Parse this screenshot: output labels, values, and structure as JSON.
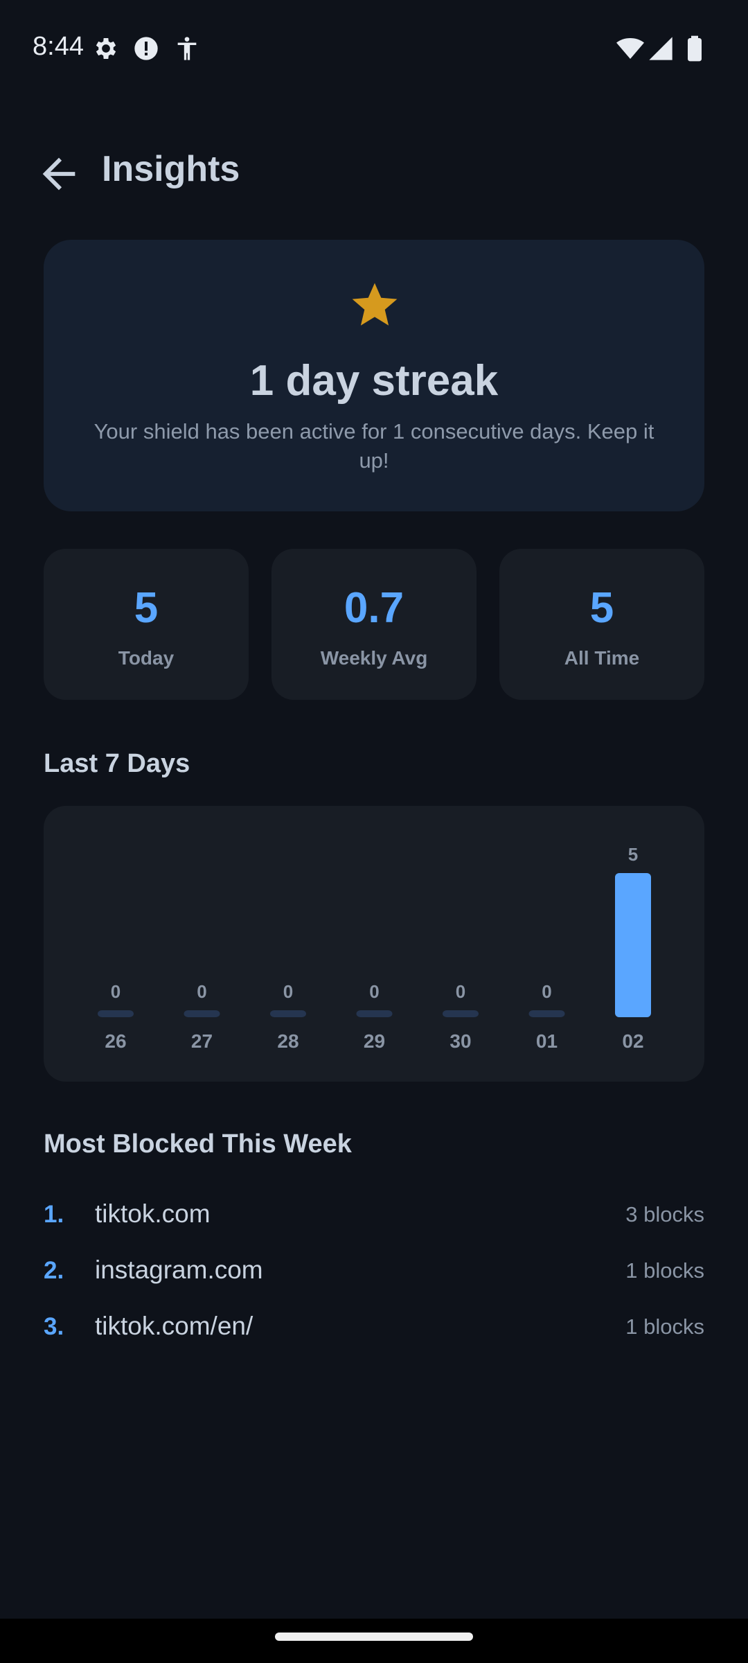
{
  "status_bar": {
    "time": "8:44",
    "left_icons": [
      "gear-icon",
      "alert-circle-icon",
      "accessibility-icon"
    ],
    "right_icons": [
      "wifi-icon",
      "cellular-signal-icon",
      "battery-icon"
    ]
  },
  "app_bar": {
    "back_icon": "arrow-left-icon",
    "title": "Insights"
  },
  "streak": {
    "icon": "star-icon",
    "star_color": "#d69a1e",
    "title": "1 day streak",
    "subtitle": "Your shield has been active for 1 consecutive days. Keep it up!"
  },
  "stats": [
    {
      "value": "5",
      "label": "Today"
    },
    {
      "value": "0.7",
      "label": "Weekly Avg"
    },
    {
      "value": "5",
      "label": "All Time"
    }
  ],
  "colors": {
    "accent": "#5aa6ff",
    "bar_empty": "#253550",
    "background": "#0e121a"
  },
  "last7": {
    "title": "Last 7 Days"
  },
  "chart_data": {
    "type": "bar",
    "categories": [
      "26",
      "27",
      "28",
      "29",
      "30",
      "01",
      "02"
    ],
    "values": [
      0,
      0,
      0,
      0,
      0,
      0,
      5
    ],
    "data_labels": [
      "0",
      "0",
      "0",
      "0",
      "0",
      "0",
      "5"
    ],
    "ylim": [
      0,
      5
    ],
    "grid": false
  },
  "most_blocked": {
    "title": "Most Blocked This Week",
    "items": [
      {
        "rank": "1.",
        "domain": "tiktok.com",
        "count": "3 blocks"
      },
      {
        "rank": "2.",
        "domain": "instagram.com",
        "count": "1 blocks"
      },
      {
        "rank": "3.",
        "domain": "tiktok.com/en/",
        "count": "1 blocks"
      }
    ]
  }
}
